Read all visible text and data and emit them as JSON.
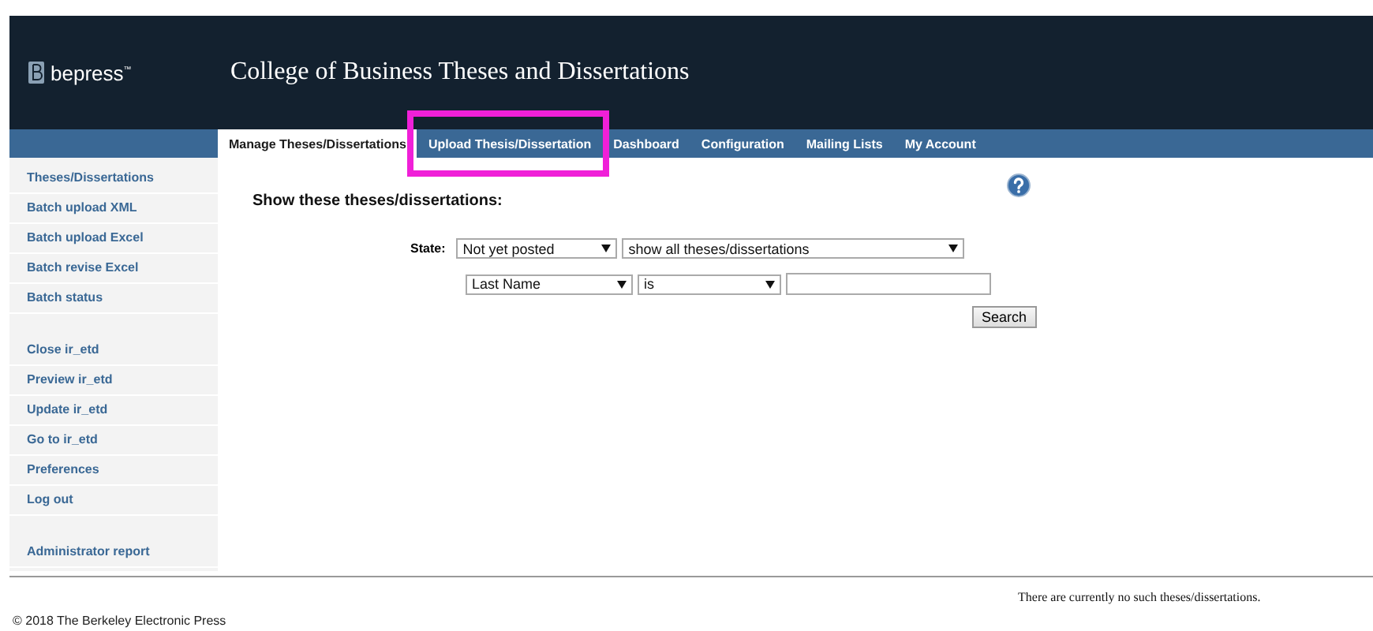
{
  "header": {
    "logo": "bepress",
    "logo_mark": "™",
    "title": "College of Business Theses and Dissertations"
  },
  "tabs": [
    {
      "label": "Manage Theses/Dissertations",
      "selected": true,
      "highlighted": false
    },
    {
      "label": "Upload Thesis/Dissertation",
      "selected": false,
      "highlighted": true
    },
    {
      "label": "Dashboard",
      "selected": false,
      "highlighted": false
    },
    {
      "label": "Configuration",
      "selected": false,
      "highlighted": false
    },
    {
      "label": "Mailing Lists",
      "selected": false,
      "highlighted": false
    },
    {
      "label": "My Account",
      "selected": false,
      "highlighted": false
    }
  ],
  "sidebar": {
    "groups": [
      [
        "Theses/Dissertations",
        "Batch upload XML",
        "Batch upload Excel",
        "Batch revise Excel",
        "Batch status"
      ],
      [
        "Close ir_etd",
        "Preview ir_etd",
        "Update ir_etd",
        "Go to ir_etd",
        "Preferences",
        "Log out"
      ],
      [
        "Administrator report"
      ]
    ]
  },
  "main": {
    "heading": "Show these theses/dissertations:",
    "state_label": "State:",
    "state_select": "Not yet posted",
    "filter_select": "show all theses/dissertations",
    "field_select": "Last Name",
    "operator_select": "is",
    "search_button": "Search"
  },
  "result_message": "There are currently no such theses/dissertations.",
  "footer": "© 2018 The Berkeley Electronic Press"
}
